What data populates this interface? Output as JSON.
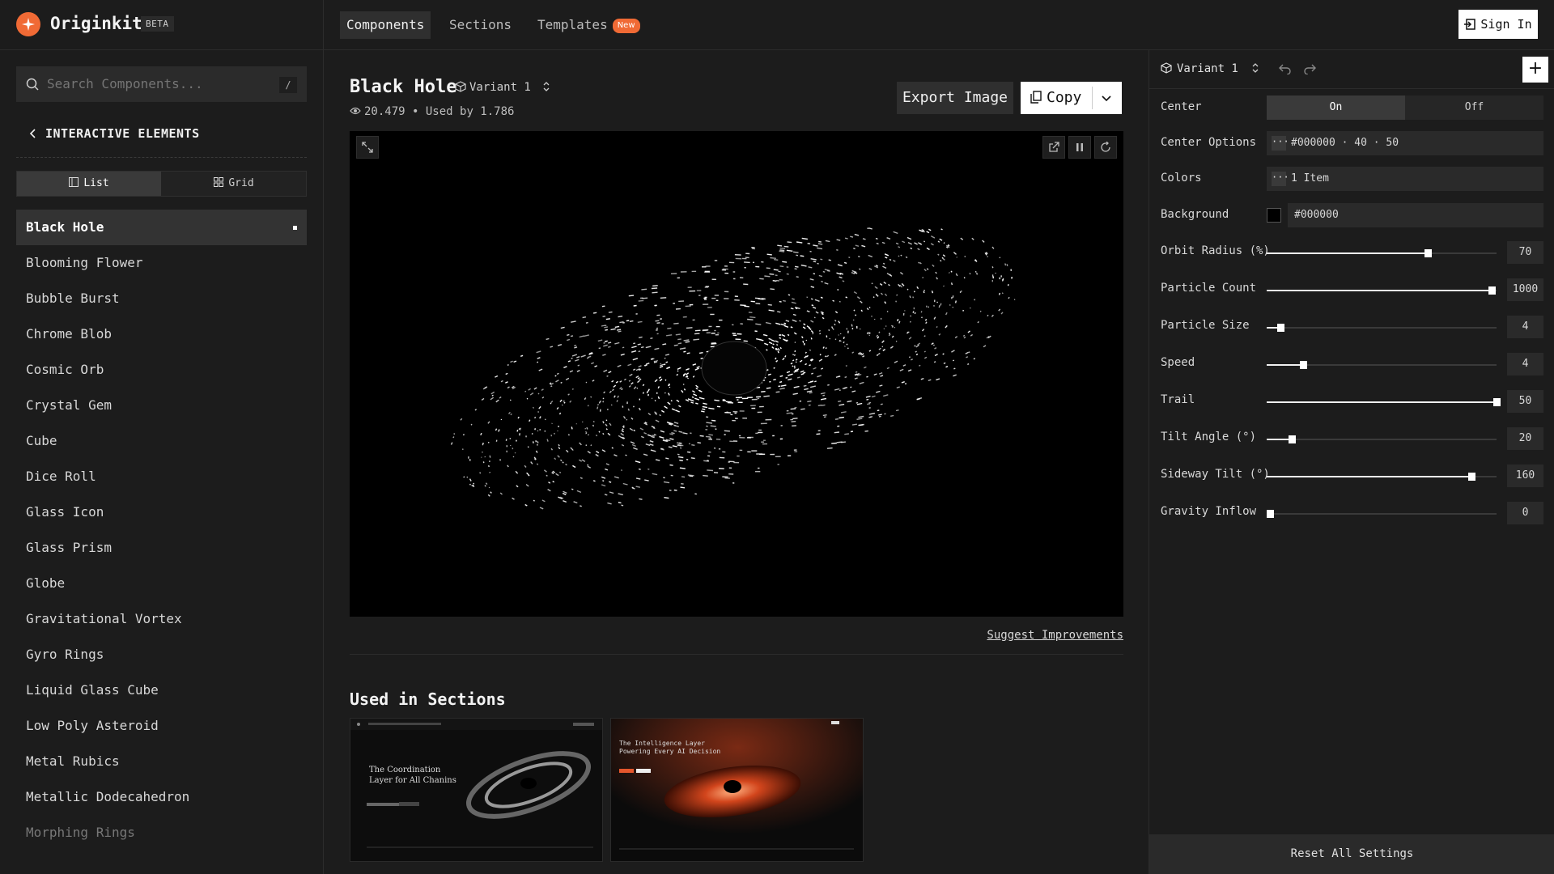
{
  "brand": {
    "name": "Originkit",
    "badge": "BETA"
  },
  "nav": {
    "tabs": [
      {
        "label": "Components",
        "active": true
      },
      {
        "label": "Sections",
        "active": false
      },
      {
        "label": "Templates",
        "active": false,
        "badge": "New"
      }
    ],
    "sign_in": "Sign In"
  },
  "sidebar": {
    "search_placeholder": "Search Components...",
    "search_shortcut": "/",
    "category": "INTERACTIVE ELEMENTS",
    "view_toggle": [
      {
        "label": "List",
        "active": true
      },
      {
        "label": "Grid",
        "active": false
      }
    ],
    "items": [
      "Black Hole",
      "Blooming Flower",
      "Bubble Burst",
      "Chrome Blob",
      "Cosmic Orb",
      "Crystal Gem",
      "Cube",
      "Dice Roll",
      "Glass Icon",
      "Glass Prism",
      "Globe",
      "Gravitational Vortex",
      "Gyro Rings",
      "Liquid Glass Cube",
      "Low Poly Asteroid",
      "Metal Rubics",
      "Metallic Dodecahedron",
      "Morphing Rings"
    ],
    "active_item": "Black Hole"
  },
  "component": {
    "title": "Black Hole",
    "variant": "Variant 1",
    "views": "20.479",
    "used_by": "Used by 1.786",
    "export_label": "Export Image",
    "copy_label": "Copy",
    "suggest": "Suggest Improvements",
    "used_in_title": "Used in Sections",
    "thumb1": {
      "headline_1": "The Coordination",
      "headline_2": "Layer for All Chanins"
    },
    "thumb2": {
      "headline_1": "The Intelligence Layer",
      "headline_2": "Powering Every AI Decision"
    }
  },
  "settings": {
    "variant": "Variant 1",
    "center": {
      "label": "Center",
      "on": "On",
      "off": "Off",
      "value": "On"
    },
    "center_options": {
      "label": "Center Options",
      "value": "#000000 · 40 · 50"
    },
    "colors": {
      "label": "Colors",
      "value": "1 Item"
    },
    "background": {
      "label": "Background",
      "value": "#000000"
    },
    "sliders": [
      {
        "label": "Orbit Radius (%)",
        "value": "70",
        "fraction": 0.7
      },
      {
        "label": "Particle Count",
        "value": "1000",
        "fraction": 0.98
      },
      {
        "label": "Particle Size",
        "value": "4",
        "fraction": 0.06
      },
      {
        "label": "Speed",
        "value": "4",
        "fraction": 0.16
      },
      {
        "label": "Trail",
        "value": "50",
        "fraction": 1.0
      },
      {
        "label": "Tilt Angle (°)",
        "value": "20",
        "fraction": 0.11
      },
      {
        "label": "Sideway Tilt (°)",
        "value": "160",
        "fraction": 0.89
      },
      {
        "label": "Gravity Inflow",
        "value": "0",
        "fraction": 0.0
      }
    ],
    "reset": "Reset All Settings"
  },
  "colors": {
    "accent": "#f06a35",
    "panel": "#1c1c1c",
    "preview_bg": "#000000"
  }
}
